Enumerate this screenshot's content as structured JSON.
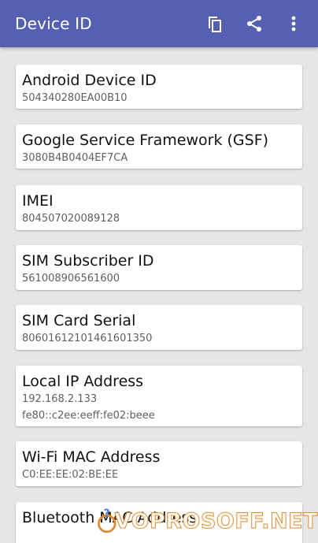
{
  "appbar": {
    "title": "Device ID",
    "actions": [
      {
        "icon": "copy-icon"
      },
      {
        "icon": "share-icon"
      },
      {
        "icon": "more-vert-icon"
      }
    ]
  },
  "colors": {
    "appbar": "#5560b3",
    "background": "#e6e6e6",
    "card": "#ffffff"
  },
  "cards": [
    {
      "title": "Android Device ID",
      "values": [
        "504340280EA00B10"
      ]
    },
    {
      "title": "Google Service Framework (GSF)",
      "values": [
        "3080B4B0404EF7CA"
      ]
    },
    {
      "title": "IMEI",
      "values": [
        "804507020089128"
      ]
    },
    {
      "title": "SIM Subscriber ID",
      "values": [
        "561008906561600"
      ]
    },
    {
      "title": "SIM Card Serial",
      "values": [
        "80601612101461601350"
      ]
    },
    {
      "title": "Local IP Address",
      "values": [
        "192.168.2.133",
        "fe80::c2ee:eeff:fe02:beee"
      ]
    },
    {
      "title": "Wi-Fi MAC Address",
      "values": [
        "C0:EE:EE:02:BE:EE"
      ]
    },
    {
      "title": "Bluetooth MAC Address",
      "values": []
    }
  ],
  "watermark": {
    "text": "VOPROSOFF.NET"
  }
}
